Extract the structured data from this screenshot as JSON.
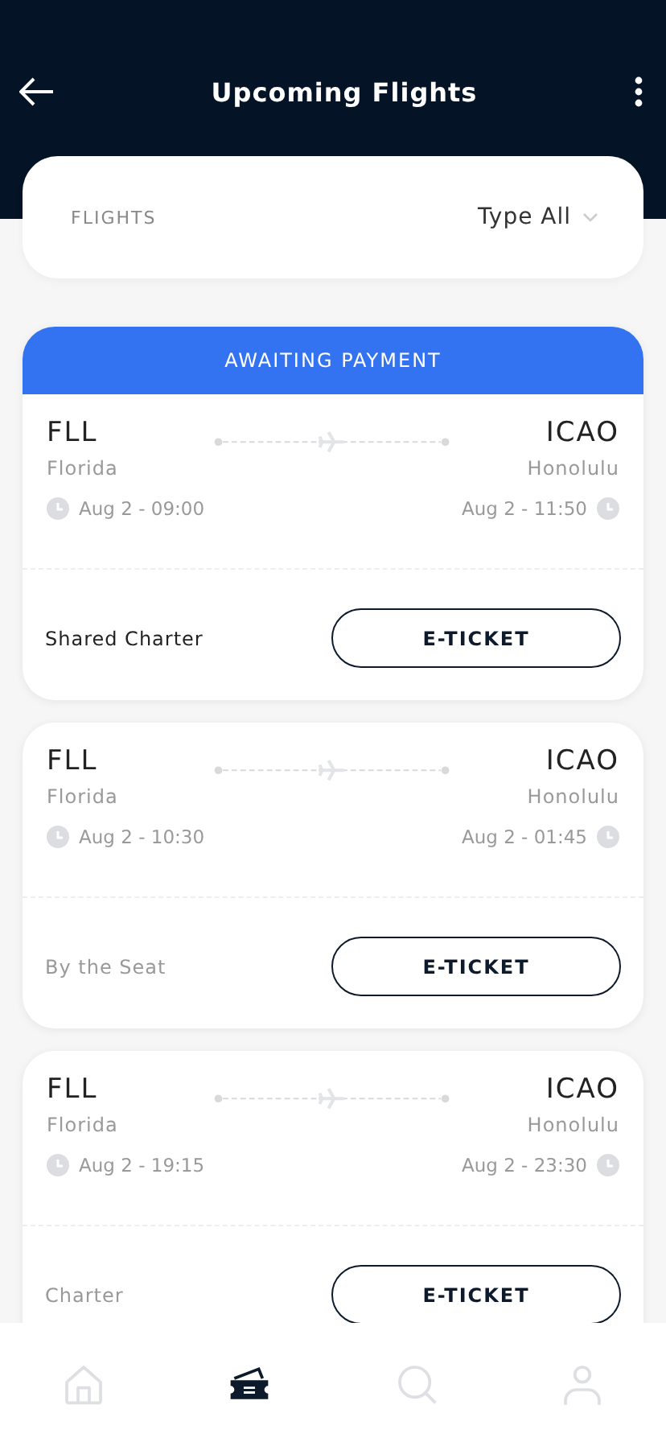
{
  "header": {
    "title": "Upcoming Flights"
  },
  "filter": {
    "label": "FLIGHTS",
    "value": "Type All"
  },
  "flights": [
    {
      "status": "AWAITING PAYMENT",
      "from_code": "FLL",
      "from_city": "Florida",
      "depart": "Aug 2 - 09:00",
      "to_code": "ICAO",
      "to_city": "Honolulu",
      "arrive": "Aug 2 - 11:50",
      "type": "Shared Charter",
      "emphasized": true,
      "button": "E-TICKET"
    },
    {
      "from_code": "FLL",
      "from_city": "Florida",
      "depart": "Aug 2 - 10:30",
      "to_code": "ICAO",
      "to_city": "Honolulu",
      "arrive": "Aug 2 - 01:45",
      "type": "By the Seat",
      "emphasized": false,
      "button": "E-TICKET"
    },
    {
      "from_code": "FLL",
      "from_city": "Florida",
      "depart": "Aug 2 - 19:15",
      "to_code": "ICAO",
      "to_city": "Honolulu",
      "arrive": "Aug 2 - 23:30",
      "type": "Charter",
      "emphasized": false,
      "button": "E-TICKET"
    }
  ],
  "nav": [
    {
      "kind": "home",
      "selected": false
    },
    {
      "kind": "tickets",
      "selected": true
    },
    {
      "kind": "search",
      "selected": false
    },
    {
      "kind": "profile",
      "selected": false
    }
  ]
}
